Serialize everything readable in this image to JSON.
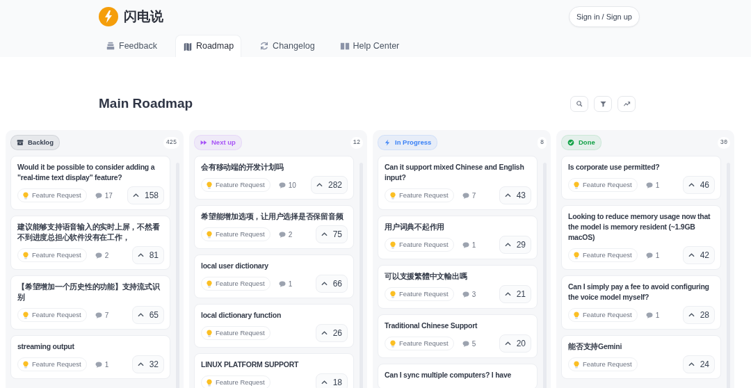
{
  "brand": {
    "name": "闪电说"
  },
  "auth_button": "Sign in / Sign up",
  "nav": [
    {
      "label": "Feedback",
      "kind": "stack",
      "selected": false
    },
    {
      "label": "Roadmap",
      "kind": "map",
      "selected": true
    },
    {
      "label": "Changelog",
      "kind": "refresh",
      "selected": false
    },
    {
      "label": "Help Center",
      "kind": "book",
      "selected": false
    }
  ],
  "page_title": "Main Roadmap",
  "tools": [
    {
      "kind": "search"
    },
    {
      "kind": "filter"
    },
    {
      "kind": "trend"
    }
  ],
  "columns": [
    {
      "name": "Backlog",
      "kind": "archive",
      "color": "#374151",
      "count": "425",
      "cards": [
        {
          "title": "Would it be possible to consider adding a \"real-time text display\" feature?",
          "tag": "Feature Request",
          "comments": "17",
          "votes": "158"
        },
        {
          "title": "建议能够支持语音输入的实时上屏，不然看不到进度总担心软件没有在工作，",
          "tag": "Feature Request",
          "comments": "2",
          "votes": "81"
        },
        {
          "title": "【希望增加一个历史性的功能】支持流式识别",
          "tag": "Feature Request",
          "comments": "7",
          "votes": "65"
        },
        {
          "title": "streaming output",
          "tag": "Feature Request",
          "comments": "1",
          "votes": "32"
        }
      ]
    },
    {
      "name": "Next up",
      "kind": "forward",
      "color": "#a855f7",
      "count": "12",
      "cards": [
        {
          "title": "会有移动端的开发计划吗",
          "tag": "Feature Request",
          "comments": "10",
          "votes": "282"
        },
        {
          "title": "希望能增加选项，让用户选择是否保留音频",
          "tag": "Feature Request",
          "comments": "2",
          "votes": "75"
        },
        {
          "title": "local user dictionary",
          "tag": "Feature Request",
          "comments": "1",
          "votes": "66"
        },
        {
          "title": "local dictionary function",
          "tag": "Feature Request",
          "votes": "26"
        },
        {
          "title": "LINUX PLATFORM SUPPORT",
          "tag": "Feature Request",
          "votes": "18"
        }
      ]
    },
    {
      "name": "In Progress",
      "kind": "bolt",
      "color": "#3b82f6",
      "count": "8",
      "cards": [
        {
          "title": "Can it support mixed Chinese and English input?",
          "tag": "Feature Request",
          "comments": "7",
          "votes": "43"
        },
        {
          "title": "用户词典不起作用",
          "tag": "Feature Request",
          "comments": "1",
          "votes": "29"
        },
        {
          "title": "可以支援繁體中文輸出嗎",
          "tag": "Feature Request",
          "comments": "3",
          "votes": "21"
        },
        {
          "title": "Traditional Chinese Support",
          "tag": "Feature Request",
          "comments": "5",
          "votes": "20"
        },
        {
          "title": "Can I sync multiple computers? I have"
        }
      ]
    },
    {
      "name": "Done",
      "kind": "check",
      "color": "#16a34a",
      "count": "30",
      "cards": [
        {
          "title": "Is corporate use permitted?",
          "tag": "Feature Request",
          "comments": "1",
          "votes": "46"
        },
        {
          "title": "Looking to reduce memory usage now that the model is memory resident (~1.9GB macOS)",
          "tag": "Feature Request",
          "comments": "1",
          "votes": "42"
        },
        {
          "title": "Can I simply pay a fee to avoid configuring the voice model myself?",
          "tag": "Feature Request",
          "comments": "1",
          "votes": "28"
        },
        {
          "title": "能否支持Gemini",
          "tag": "Feature Request",
          "votes": "24"
        }
      ]
    }
  ]
}
